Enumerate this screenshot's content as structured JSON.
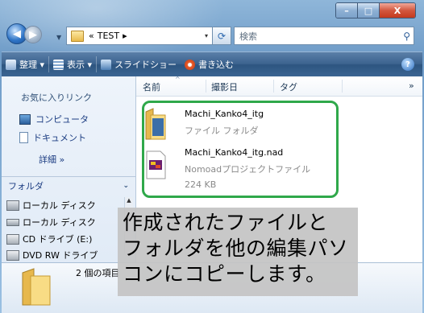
{
  "window": {
    "caption_buttons": [
      "–",
      "□",
      "X"
    ]
  },
  "address": {
    "separator": "«",
    "path": "TEST",
    "arrow": "▸",
    "dropdown": "▾"
  },
  "search": {
    "placeholder": "検索"
  },
  "toolbar": {
    "organize": "整理 ▾",
    "view": "表示 ▾",
    "slideshow": "スライドショー",
    "burn": "書き込む",
    "help": "?"
  },
  "sidebar": {
    "favorites_title": "お気に入りリンク",
    "favorites": [
      "コンピュータ",
      "ドキュメント"
    ],
    "more": "詳細 »",
    "folders_label": "フォルダ",
    "folders_chevron": "⌄",
    "tree": [
      "ローカル ディスク",
      "ローカル ディスク",
      "CD ドライブ (E:)",
      "DVD RW ドライブ"
    ]
  },
  "columns": {
    "name": "名前",
    "date_taken": "撮影日",
    "tags": "タグ",
    "more": "»"
  },
  "files": [
    {
      "name": "Machi_Kanko4_itg",
      "type": "ファイル フォルダ"
    },
    {
      "name": "Machi_Kanko4_itg.nad",
      "type": "Nomoadプロジェクトファイル",
      "size": "224 KB"
    }
  ],
  "status": {
    "count": "2 個の項目"
  },
  "overlay": {
    "line1": "作成されたファイルと",
    "line2": "フォルダを他の編集パソ",
    "line3": "コンにコピーします。"
  },
  "colors": {
    "highlight": "#2fa84a",
    "toolbar": "#3c638f",
    "overlay_bg": "#c4c4c4"
  }
}
